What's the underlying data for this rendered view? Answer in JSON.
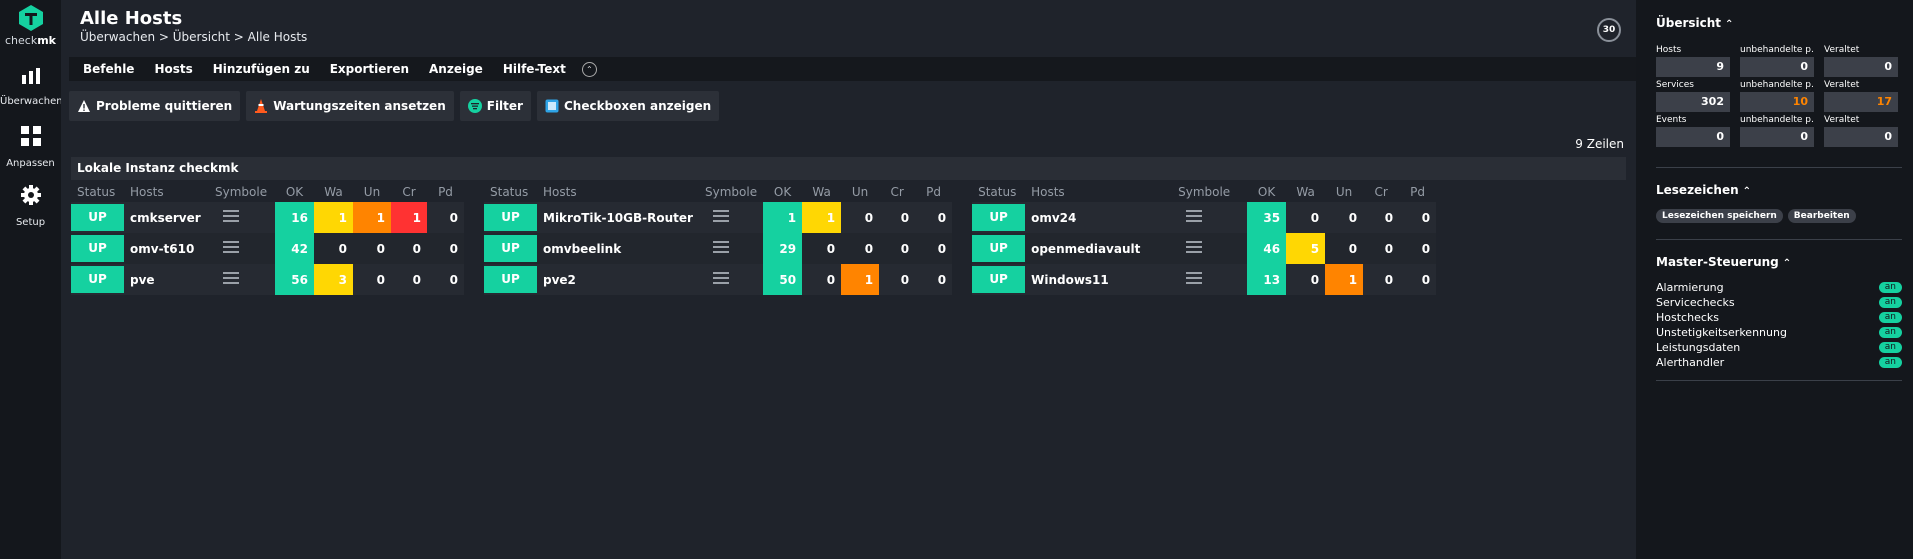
{
  "nav": {
    "logo_text_a": "check",
    "logo_text_b": "mk",
    "items": [
      {
        "label": "Überwachen",
        "icon": "bar-chart-icon"
      },
      {
        "label": "Anpassen",
        "icon": "grid-icon"
      },
      {
        "label": "Setup",
        "icon": "gear-icon"
      }
    ]
  },
  "header": {
    "title": "Alle Hosts",
    "breadcrumb": "Überwachen > Übersicht > Alle Hosts",
    "refresh_seconds": "30"
  },
  "menubar": [
    "Befehle",
    "Hosts",
    "Hinzufügen zu",
    "Exportieren",
    "Anzeige",
    "Hilfe-Text"
  ],
  "actions": [
    {
      "label": "Probleme quittieren",
      "icon": "warning-icon"
    },
    {
      "label": "Wartungszeiten ansetzen",
      "icon": "traffic-cone-icon"
    },
    {
      "label": "Filter",
      "icon": "filter-icon"
    },
    {
      "label": "Checkboxen anzeigen",
      "icon": "checkbox-icon"
    }
  ],
  "row_count": "9 Zeilen",
  "instance": "Lokale Instanz checkmk",
  "columns": [
    "Status",
    "Hosts",
    "Symbole",
    "OK",
    "Wa",
    "Un",
    "Cr",
    "Pd"
  ],
  "hosts": [
    {
      "status": "UP",
      "name": "cmkserver",
      "ok": "16",
      "wa": "1",
      "un": "1",
      "cr": "1",
      "pd": "0"
    },
    {
      "status": "UP",
      "name": "MikroTik-10GB-Router",
      "ok": "1",
      "wa": "1",
      "un": "0",
      "cr": "0",
      "pd": "0"
    },
    {
      "status": "UP",
      "name": "omv24",
      "ok": "35",
      "wa": "0",
      "un": "0",
      "cr": "0",
      "pd": "0"
    },
    {
      "status": "UP",
      "name": "omv-t610",
      "ok": "42",
      "wa": "0",
      "un": "0",
      "cr": "0",
      "pd": "0"
    },
    {
      "status": "UP",
      "name": "omvbeelink",
      "ok": "29",
      "wa": "0",
      "un": "0",
      "cr": "0",
      "pd": "0"
    },
    {
      "status": "UP",
      "name": "openmediavault",
      "ok": "46",
      "wa": "5",
      "un": "0",
      "cr": "0",
      "pd": "0"
    },
    {
      "status": "UP",
      "name": "pve",
      "ok": "56",
      "wa": "3",
      "un": "0",
      "cr": "0",
      "pd": "0"
    },
    {
      "status": "UP",
      "name": "pve2",
      "ok": "50",
      "wa": "0",
      "un": "1",
      "cr": "0",
      "pd": "0"
    },
    {
      "status": "UP",
      "name": "Windows11",
      "ok": "13",
      "wa": "0",
      "un": "1",
      "cr": "0",
      "pd": "0"
    }
  ],
  "sidebar": {
    "overview": {
      "title": "Übersicht",
      "rows": [
        {
          "label": "Hosts",
          "total": "9",
          "unhandled_label": "unbehandelte p.",
          "unhandled": "0",
          "stale_label": "Veraltet",
          "stale": "0"
        },
        {
          "label": "Services",
          "total": "302",
          "unhandled_label": "unbehandelte p.",
          "unhandled": "10",
          "stale_label": "Veraltet",
          "stale": "17"
        },
        {
          "label": "Events",
          "total": "0",
          "unhandled_label": "unbehandelte p.",
          "unhandled": "0",
          "stale_label": "Veraltet",
          "stale": "0"
        }
      ]
    },
    "bookmarks": {
      "title": "Lesezeichen",
      "save": "Lesezeichen speichern",
      "edit": "Bearbeiten"
    },
    "master": {
      "title": "Master-Steuerung",
      "items": [
        {
          "label": "Alarmierung",
          "state": "an"
        },
        {
          "label": "Servicechecks",
          "state": "an"
        },
        {
          "label": "Hostchecks",
          "state": "an"
        },
        {
          "label": "Unstetigkeitserkennung",
          "state": "an"
        },
        {
          "label": "Leistungsdaten",
          "state": "an"
        },
        {
          "label": "Alerthandler",
          "state": "an"
        }
      ]
    }
  },
  "colors": {
    "ok": "#15d1a0",
    "warn": "#ffd703",
    "unknown": "#ff8400",
    "crit": "#ff3232"
  }
}
